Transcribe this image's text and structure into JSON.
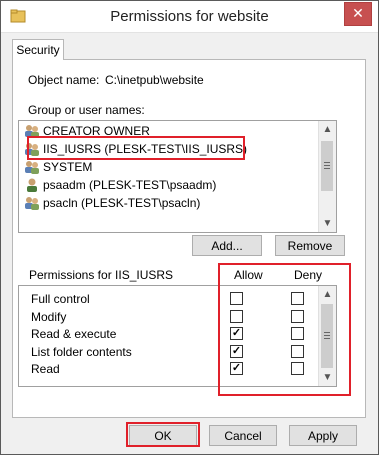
{
  "window": {
    "title": "Permissions for website",
    "close_glyph": "✕"
  },
  "tabs": [
    {
      "label": "Security"
    }
  ],
  "object": {
    "label": "Object name:",
    "value": "C:\\inetpub\\website"
  },
  "groups": {
    "label": "Group or user names:",
    "items": [
      {
        "name": "CREATOR OWNER",
        "icon": "users-group-icon"
      },
      {
        "name": "IIS_IUSRS (PLESK-TEST\\IIS_IUSRS)",
        "icon": "users-group-icon"
      },
      {
        "name": "SYSTEM",
        "icon": "users-group-icon"
      },
      {
        "name": "psaadm (PLESK-TEST\\psaadm)",
        "icon": "user-icon"
      },
      {
        "name": "psacln (PLESK-TEST\\psacln)",
        "icon": "users-group-icon"
      }
    ],
    "selected_index": 1
  },
  "buttons": {
    "add": "Add...",
    "remove": "Remove",
    "ok": "OK",
    "cancel": "Cancel",
    "apply": "Apply"
  },
  "permissions": {
    "label": "Permissions for IIS_IUSRS",
    "allow_header": "Allow",
    "deny_header": "Deny",
    "rows": [
      {
        "name": "Full control",
        "allow": false,
        "deny": false
      },
      {
        "name": "Modify",
        "allow": false,
        "deny": false
      },
      {
        "name": "Read & execute",
        "allow": true,
        "deny": false
      },
      {
        "name": "List folder contents",
        "allow": true,
        "deny": false
      },
      {
        "name": "Read",
        "allow": true,
        "deny": false
      }
    ]
  },
  "colors": {
    "highlight": "#e0202a",
    "accent": "#0078d7"
  }
}
